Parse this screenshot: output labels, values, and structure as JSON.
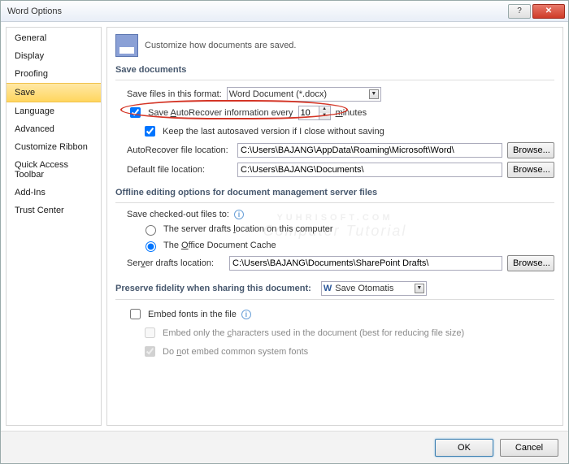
{
  "window": {
    "title": "Word Options"
  },
  "sidebar": {
    "items": [
      {
        "label": "General"
      },
      {
        "label": "Display"
      },
      {
        "label": "Proofing"
      },
      {
        "label": "Save"
      },
      {
        "label": "Language"
      },
      {
        "label": "Advanced"
      },
      {
        "label": "Customize Ribbon"
      },
      {
        "label": "Quick Access Toolbar"
      },
      {
        "label": "Add-Ins"
      },
      {
        "label": "Trust Center"
      }
    ],
    "active_index": 3
  },
  "header": {
    "subtitle": "Customize how documents are saved."
  },
  "save_documents": {
    "title": "Save documents",
    "format_label": "Save files in this format:",
    "format_value": "Word Document (*.docx)",
    "autorecover_checked": true,
    "autorecover_label_pre": "Save ",
    "autorecover_label_u": "A",
    "autorecover_label_post": "utoRecover information every",
    "autorecover_value": "10",
    "autorecover_minutes_u": "m",
    "autorecover_minutes_post": "inutes",
    "keep_last_checked": true,
    "keep_last_label": "Keep the last autosaved version if I close without saving",
    "ar_location_label": "AutoRecover file location:",
    "ar_location_value": "C:\\Users\\BAJANG\\AppData\\Roaming\\Microsoft\\Word\\",
    "default_location_label": "Default file location:",
    "default_location_value": "C:\\Users\\BAJANG\\Documents\\",
    "browse": "Browse..."
  },
  "offline": {
    "title": "Offline editing options for document management server files",
    "checkedout_label_pre": "Save checked-out files to:",
    "opt_server_u": "l",
    "opt_server_pre": "The server drafts ",
    "opt_server_post": "ocation on this computer",
    "opt_cache_u": "O",
    "opt_cache_pre": "The ",
    "opt_cache_post": "ffice Document Cache",
    "selected": "cache",
    "drafts_label_u": "v",
    "drafts_label_pre": "Ser",
    "drafts_label_post": "er drafts location:",
    "drafts_value": "C:\\Users\\BAJANG\\Documents\\SharePoint Drafts\\",
    "browse": "Browse..."
  },
  "preserve": {
    "title": "Preserve fidelity when sharing this document:",
    "doc_name": "Save Otomatis",
    "embed_checked": false,
    "embed_label_pre": "Embed fonts in the file",
    "only_chars_label_u": "c",
    "only_chars_pre": "Embed only the ",
    "only_chars_post": "haracters used in the document (best for reducing file size)",
    "no_common_label_u": "n",
    "no_common_pre": "Do ",
    "no_common_post": "ot embed common system fonts"
  },
  "footer": {
    "ok": "OK",
    "cancel": "Cancel"
  },
  "watermark": {
    "line1": "YUHRISOFT.COM",
    "line2": "Computer Tutorial"
  }
}
